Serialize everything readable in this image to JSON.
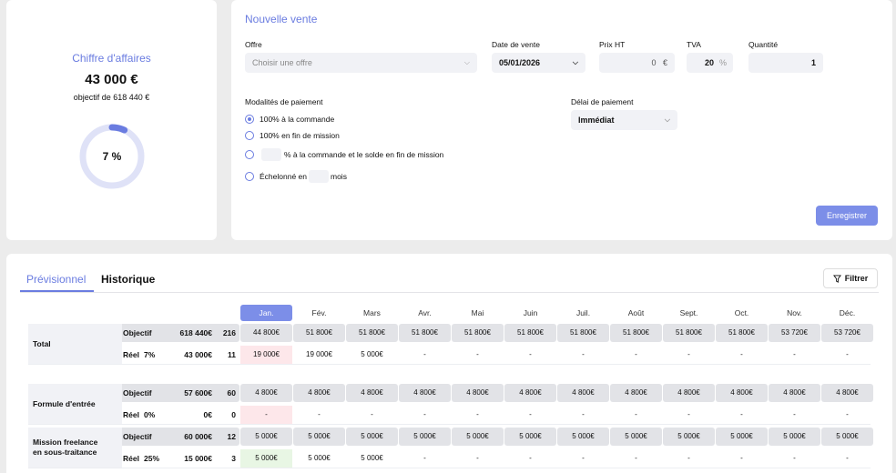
{
  "ca": {
    "title": "Chiffre d'affaires",
    "amount": "43 000 €",
    "objective": "objectif de 618 440 €",
    "progress_label": "7 %",
    "progress": 0.07,
    "colors": {
      "accent": "#6a7ce0",
      "track": "#dfe2f7"
    }
  },
  "vente": {
    "title": "Nouvelle vente",
    "offre_label": "Offre",
    "offre_placeholder": "Choisir une offre",
    "date_label": "Date de vente",
    "date_value": "05/01/2026",
    "prix_label": "Prix HT",
    "prix_value": "0",
    "prix_unit": "€",
    "tva_label": "TVA",
    "tva_value": "20",
    "tva_unit": "%",
    "qte_label": "Quantité",
    "qte_value": "1",
    "modalites_label": "Modalités de paiement",
    "opt1": "100% à la commande",
    "opt2": "100% en fin de mission",
    "opt3": "% à la commande et le solde en fin de mission",
    "opt4a": "Échelonné en",
    "opt4b": "mois",
    "delai_label": "Délai de paiement",
    "delai_value": "Immédiat",
    "save": "Enregistrer"
  },
  "tabs": {
    "prev": "Prévisionnel",
    "hist": "Historique",
    "filter": "Filtrer"
  },
  "months": [
    "Jan.",
    "Fév.",
    "Mars",
    "Avr.",
    "Mai",
    "Juin",
    "Juil.",
    "Août",
    "Sept.",
    "Oct.",
    "Nov.",
    "Déc."
  ],
  "rows": [
    {
      "label": "Total",
      "obj": {
        "name": "Objectif",
        "amount": "618 440€",
        "count": "216",
        "cells": [
          "44 800€",
          "51 800€",
          "51 800€",
          "51 800€",
          "51 800€",
          "51 800€",
          "51 800€",
          "51 800€",
          "51 800€",
          "51 800€",
          "53 720€",
          "53 720€"
        ]
      },
      "reel": {
        "name": "Réel",
        "pct": "7%",
        "amount": "43 000€",
        "count": "11",
        "cells": [
          "19 000€",
          "19 000€",
          "5 000€",
          "-",
          "-",
          "-",
          "-",
          "-",
          "-",
          "-",
          "-",
          "-"
        ],
        "status": "pink"
      }
    },
    {
      "label": "Formule d'entrée",
      "obj": {
        "name": "Objectif",
        "amount": "57 600€",
        "count": "60",
        "cells": [
          "4 800€",
          "4 800€",
          "4 800€",
          "4 800€",
          "4 800€",
          "4 800€",
          "4 800€",
          "4 800€",
          "4 800€",
          "4 800€",
          "4 800€",
          "4 800€"
        ]
      },
      "reel": {
        "name": "Réel",
        "pct": "0%",
        "amount": "0€",
        "count": "0",
        "cells": [
          "-",
          "-",
          "-",
          "-",
          "-",
          "-",
          "-",
          "-",
          "-",
          "-",
          "-",
          "-"
        ],
        "status": "pink"
      }
    },
    {
      "label": "Mission freelance en sous-traitance",
      "obj": {
        "name": "Objectif",
        "amount": "60 000€",
        "count": "12",
        "cells": [
          "5 000€",
          "5 000€",
          "5 000€",
          "5 000€",
          "5 000€",
          "5 000€",
          "5 000€",
          "5 000€",
          "5 000€",
          "5 000€",
          "5 000€",
          "5 000€"
        ]
      },
      "reel": {
        "name": "Réel",
        "pct": "25%",
        "amount": "15 000€",
        "count": "3",
        "cells": [
          "5 000€",
          "5 000€",
          "5 000€",
          "-",
          "-",
          "-",
          "-",
          "-",
          "-",
          "-",
          "-",
          "-"
        ],
        "status": "green"
      }
    }
  ]
}
